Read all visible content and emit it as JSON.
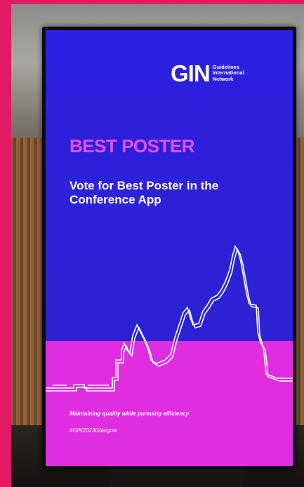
{
  "photo": {
    "subject": "digital-signage-display"
  },
  "logo": {
    "mark": "GIN",
    "line1": "Guidelines",
    "line2": "International",
    "line3": "Network"
  },
  "poster": {
    "title": "BEST POSTER",
    "subtitle": "Vote for Best Poster in the Conference App",
    "tagline": "Maintaining quality while pursuing efficiency",
    "hashtag": "#GIN2023Glasgow"
  },
  "colors": {
    "frame": "#e11a63",
    "screen_blue": "#2e22d6",
    "magenta": "#e02de0",
    "title": "#e84ff0"
  }
}
